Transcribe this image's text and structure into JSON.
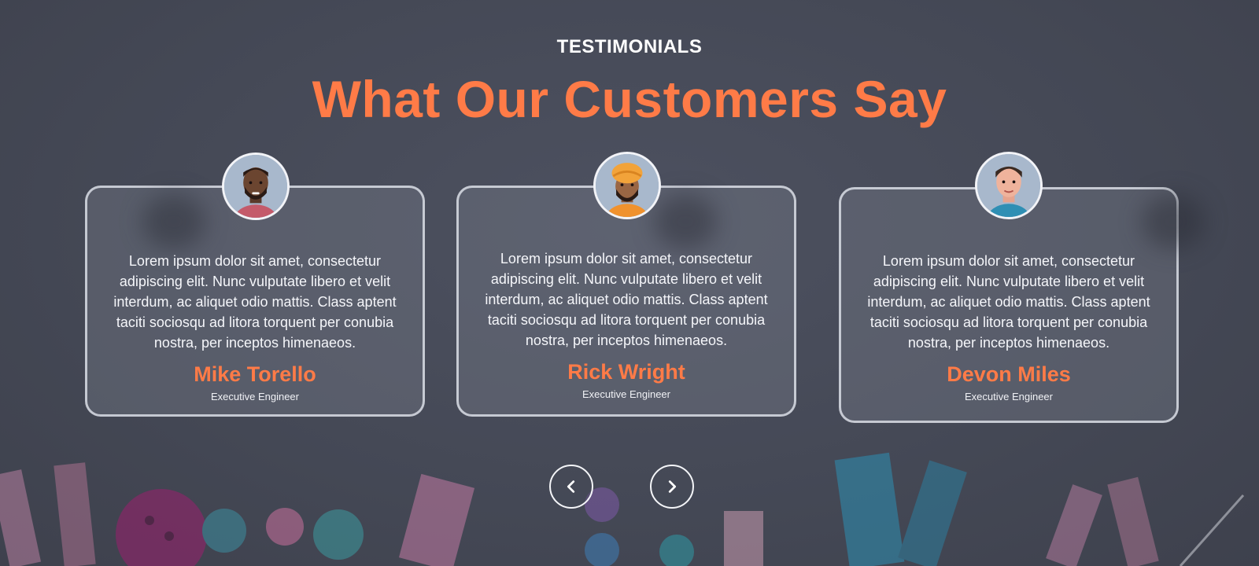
{
  "section": {
    "eyebrow": "TESTIMONIALS",
    "title": "What Our Customers Say"
  },
  "testimonials": [
    {
      "quote": "Lorem ipsum dolor sit amet, consectetur adipiscing elit. Nunc vulputate libero et velit interdum, ac aliquet odio mattis. Class aptent taciti sociosqu ad litora torquent per conubia nostra, per inceptos himenaeos.",
      "name": "Mike Torello",
      "role": "Executive Engineer",
      "avatar": "avatar-man-dark-beard-icon"
    },
    {
      "quote": "Lorem ipsum dolor sit amet, consectetur adipiscing elit. Nunc vulputate libero et velit interdum, ac aliquet odio mattis. Class aptent taciti sociosqu ad litora torquent per conubia nostra, per inceptos himenaeos.",
      "name": "Rick Wright",
      "role": "Executive Engineer",
      "avatar": "avatar-man-turban-icon"
    },
    {
      "quote": "Lorem ipsum dolor sit amet, consectetur adipiscing elit. Nunc vulputate libero et velit interdum, ac aliquet odio mattis. Class aptent taciti sociosqu ad litora torquent per conubia nostra, per inceptos himenaeos.",
      "name": "Devon Miles",
      "role": "Executive Engineer",
      "avatar": "avatar-man-short-hair-icon"
    }
  ],
  "navigation": {
    "prev_icon": "chevron-left-icon",
    "next_icon": "chevron-right-icon"
  },
  "colors": {
    "accent": "#ff7b47",
    "background": "#464a57",
    "card_border": "#ebeef5"
  }
}
